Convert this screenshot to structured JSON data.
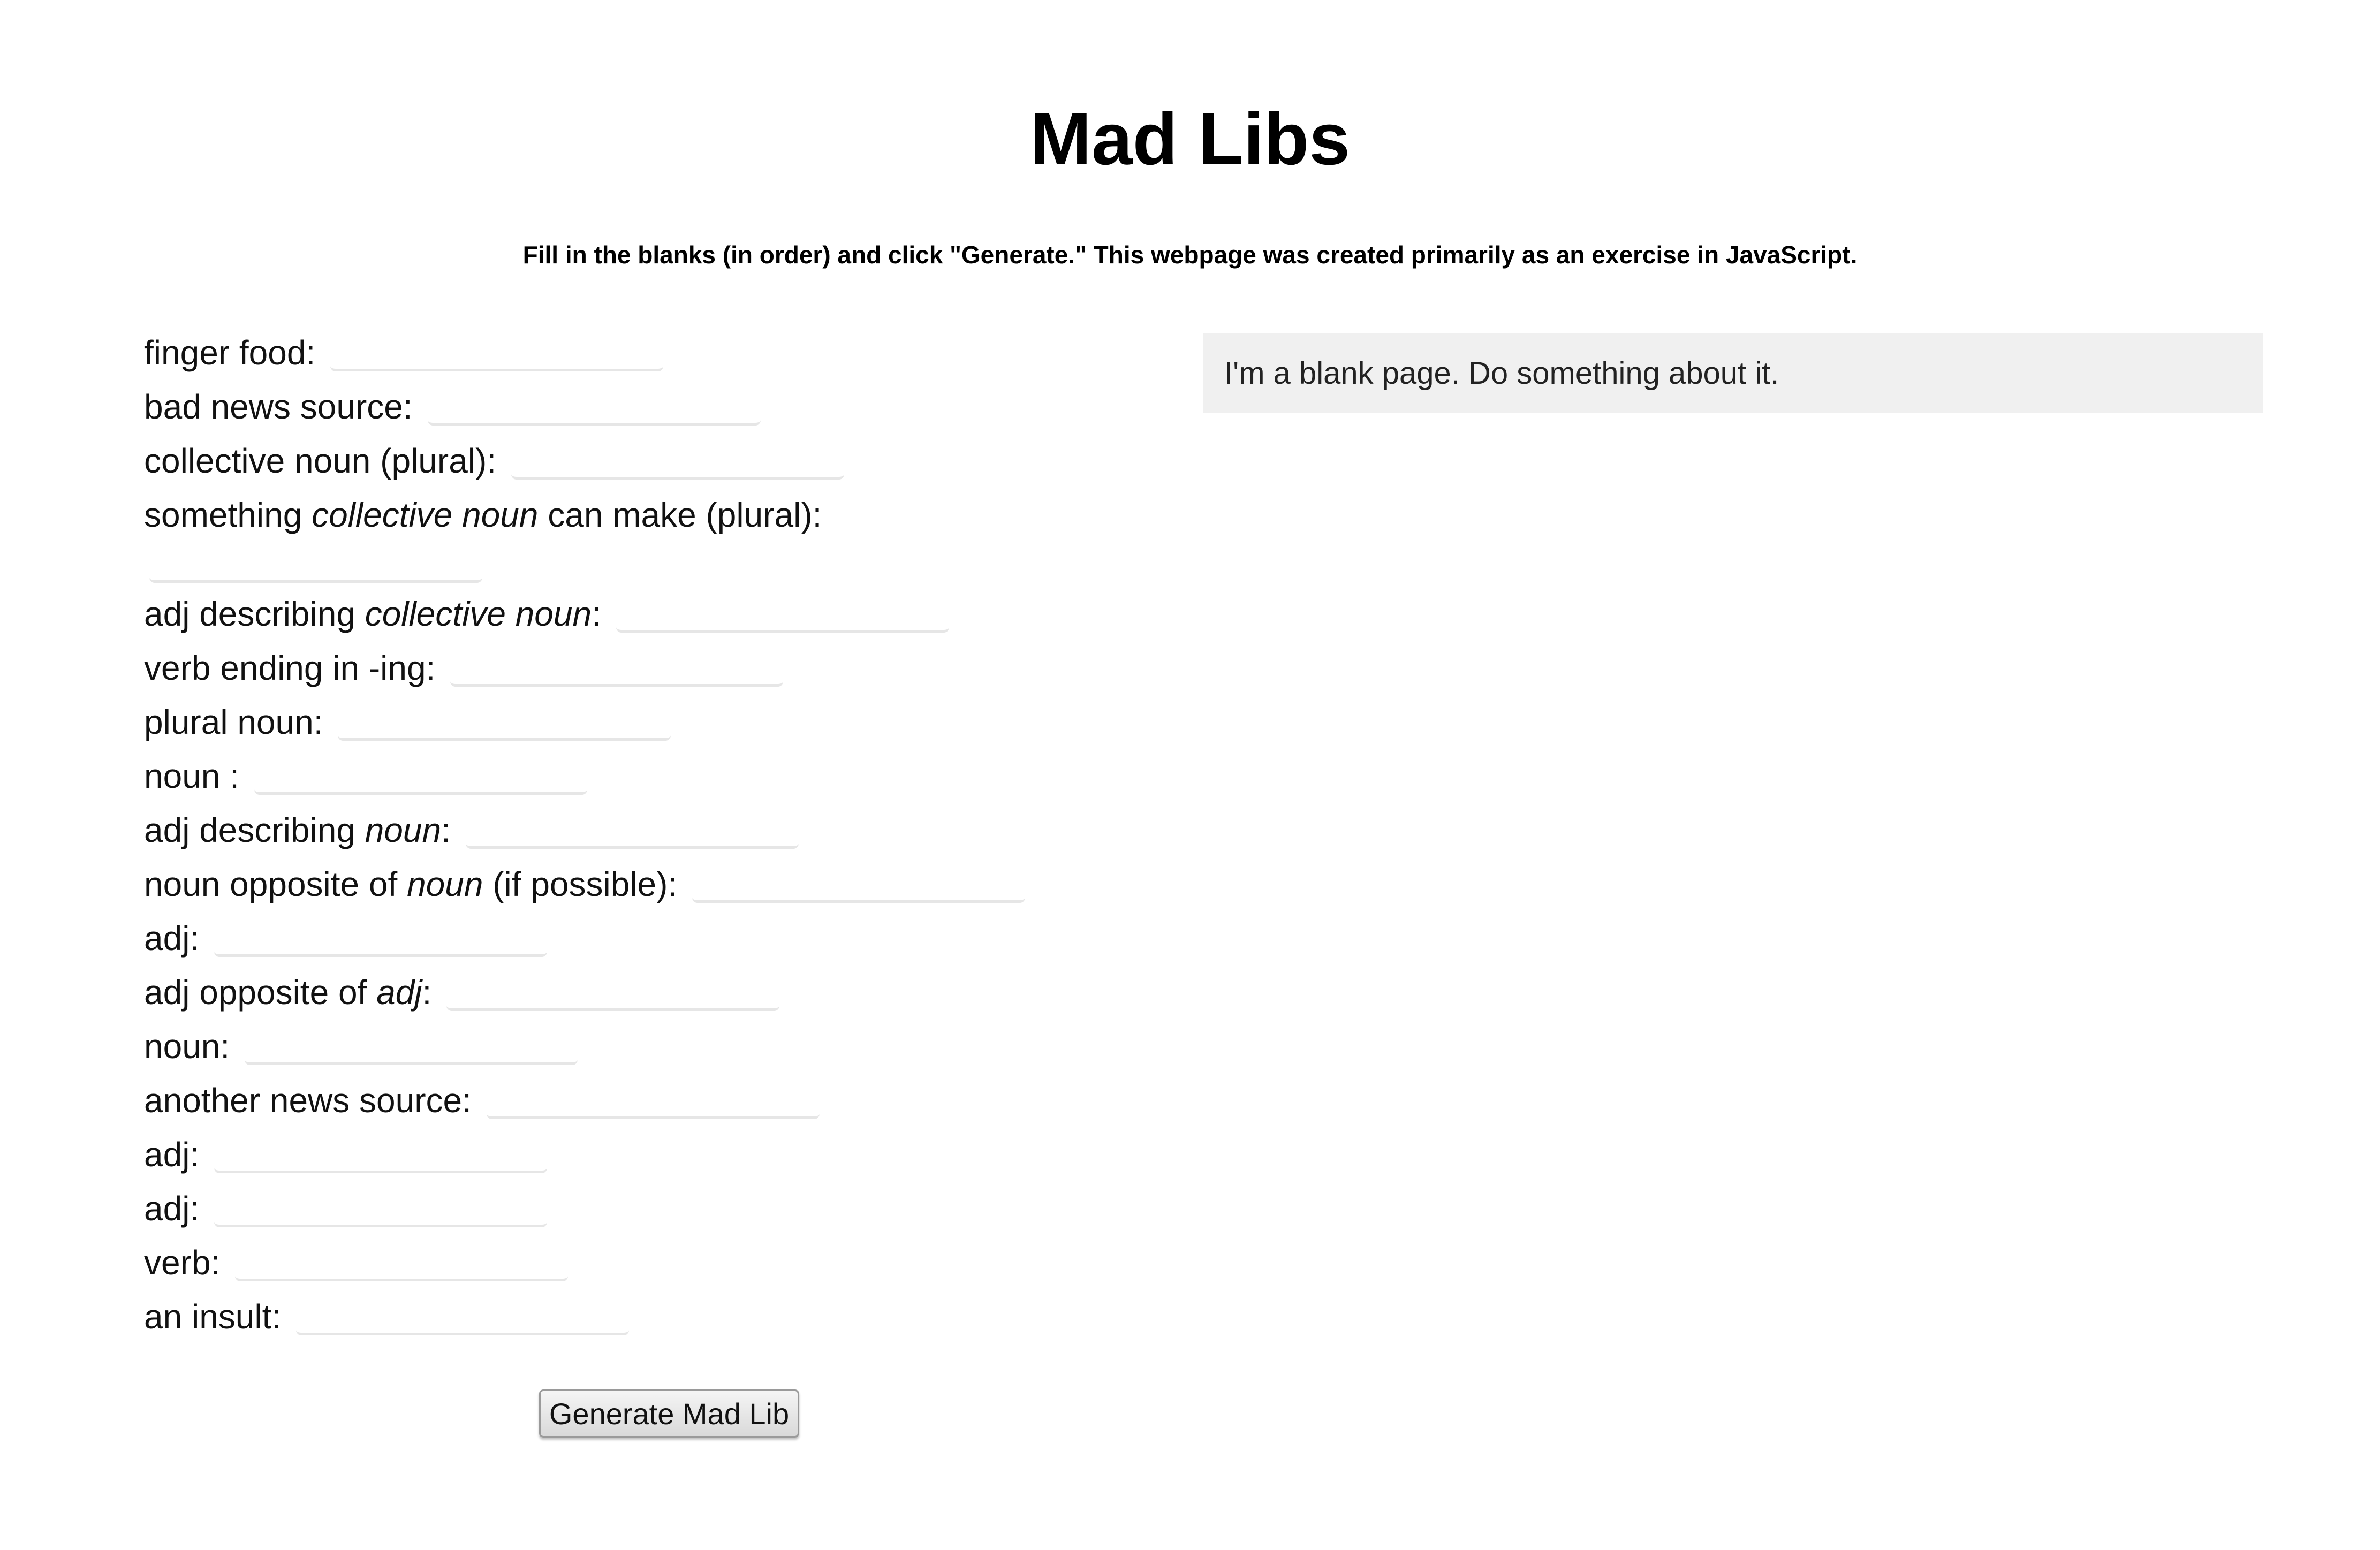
{
  "header": {
    "title": "Mad Libs",
    "subtitle": "Fill in the blanks (in order) and click \"Generate.\" This webpage was created primarily as an exercise in JavaScript."
  },
  "form": {
    "fields": [
      {
        "label": [
          "finger food:"
        ],
        "value": ""
      },
      {
        "label": [
          "bad news source:"
        ],
        "value": ""
      },
      {
        "label": [
          "collective noun (plural):"
        ],
        "value": ""
      },
      {
        "label_parts": {
          "a": "something ",
          "b": "collective noun",
          "c": " can make (plural):"
        },
        "value": ""
      },
      {
        "label_parts": {
          "a": "adj describing ",
          "b": "collective noun",
          "c": ":"
        },
        "value": ""
      },
      {
        "label": [
          "verb ending in -ing:"
        ],
        "value": ""
      },
      {
        "label": [
          "plural noun:"
        ],
        "value": ""
      },
      {
        "label": [
          "noun :"
        ],
        "value": ""
      },
      {
        "label_parts": {
          "a": "adj describing ",
          "b": "noun",
          "c": ":"
        },
        "value": ""
      },
      {
        "label_parts": {
          "a": "noun opposite of ",
          "b": "noun",
          "c": " (if possible):"
        },
        "value": ""
      },
      {
        "label": [
          "adj:"
        ],
        "value": ""
      },
      {
        "label_parts": {
          "a": "adj opposite of ",
          "b": "adj",
          "c": ":"
        },
        "value": ""
      },
      {
        "label": [
          "noun:"
        ],
        "value": ""
      },
      {
        "label": [
          "another news source:"
        ],
        "value": ""
      },
      {
        "label": [
          "adj:"
        ],
        "value": ""
      },
      {
        "label": [
          "adj:"
        ],
        "value": ""
      },
      {
        "label": [
          "verb:"
        ],
        "value": ""
      },
      {
        "label": [
          "an insult:"
        ],
        "value": ""
      }
    ],
    "l": {
      "f0": "finger food:",
      "f1": "bad news source:",
      "f2": "collective noun (plural):",
      "f3a": "something ",
      "f3b": "collective noun",
      "f3c": " can make (plural):",
      "f4a": "adj describing ",
      "f4b": "collective noun",
      "f4c": ":",
      "f5": "verb ending in -ing:",
      "f6": "plural noun:",
      "f7": "noun :",
      "f8a": "adj describing ",
      "f8b": "noun",
      "f8c": ":",
      "f9a": "noun opposite of ",
      "f9b": "noun",
      "f9c": " (if possible):",
      "f10": "adj:",
      "f11a": "adj opposite of ",
      "f11b": "adj",
      "f11c": ":",
      "f12": "noun:",
      "f13": "another news source:",
      "f14": "adj:",
      "f15": "adj:",
      "f16": "verb:",
      "f17": "an insult:"
    },
    "generate_label": "Generate Mad Lib"
  },
  "output": {
    "text": "I'm a blank page. Do something about it."
  },
  "colors": {
    "output_background": "#f0f0f0",
    "field_underline": "#e6e6e6"
  }
}
